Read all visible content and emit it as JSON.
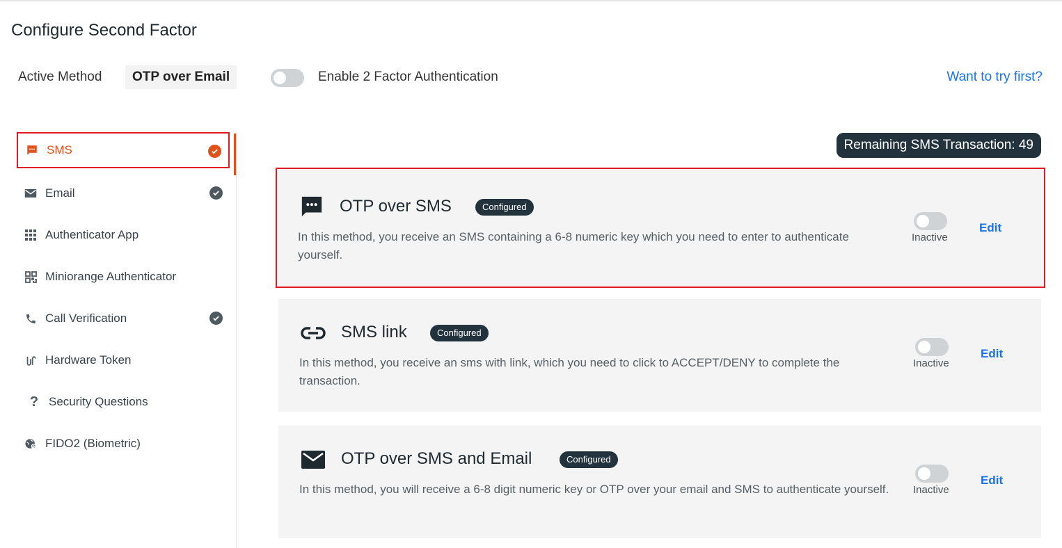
{
  "page": {
    "title": "Configure Second Factor"
  },
  "header": {
    "active_method_label": "Active Method",
    "active_method_value": "OTP over Email",
    "enable_2fa_label": "Enable 2 Factor Authentication",
    "enable_2fa_on": false,
    "try_first_link": "Want to try first?"
  },
  "sidebar": {
    "items": [
      {
        "label": "SMS",
        "icon": "chat-icon",
        "checked": true,
        "active": true
      },
      {
        "label": "Email",
        "icon": "mail-icon",
        "checked": true,
        "active": false
      },
      {
        "label": "Authenticator App",
        "icon": "grid-icon",
        "checked": false,
        "active": false
      },
      {
        "label": "Miniorange Authenticator",
        "icon": "qr-icon",
        "checked": false,
        "active": false
      },
      {
        "label": "Call Verification",
        "icon": "phone-icon",
        "checked": true,
        "active": false
      },
      {
        "label": "Hardware Token",
        "icon": "usb-key-icon",
        "checked": false,
        "active": false
      },
      {
        "label": "Security Questions",
        "icon": "question-icon",
        "checked": false,
        "active": false
      },
      {
        "label": "FIDO2 (Biometric)",
        "icon": "fingerprint-globe-icon",
        "checked": false,
        "active": false
      }
    ]
  },
  "remaining_sms": "Remaining SMS Transaction: 49",
  "methods": [
    {
      "title": "OTP over SMS",
      "badge": "Configured",
      "icon": "chat-dots-icon",
      "description": "In this method, you receive an SMS containing a 6-8 numeric key which you need to enter to authenticate yourself.",
      "status": "Inactive",
      "edit_label": "Edit",
      "enabled": false
    },
    {
      "title": "SMS link",
      "badge": "Configured",
      "icon": "link-icon",
      "description": "In this method, you receive an sms with link, which you need to click to ACCEPT/DENY to complete the transaction.",
      "status": "Inactive",
      "edit_label": "Edit",
      "enabled": false
    },
    {
      "title": "OTP over SMS and Email",
      "badge": "Configured",
      "icon": "envelope-icon",
      "description": "In this method, you will receive a 6-8 digit numeric key or OTP over your email and SMS to authenticate yourself.",
      "status": "Inactive",
      "edit_label": "Edit",
      "enabled": false
    }
  ],
  "colors": {
    "accent": "#e0521c",
    "link": "#1a73e8",
    "badge_bg": "#22333d",
    "highlight_border": "#e01b24"
  }
}
